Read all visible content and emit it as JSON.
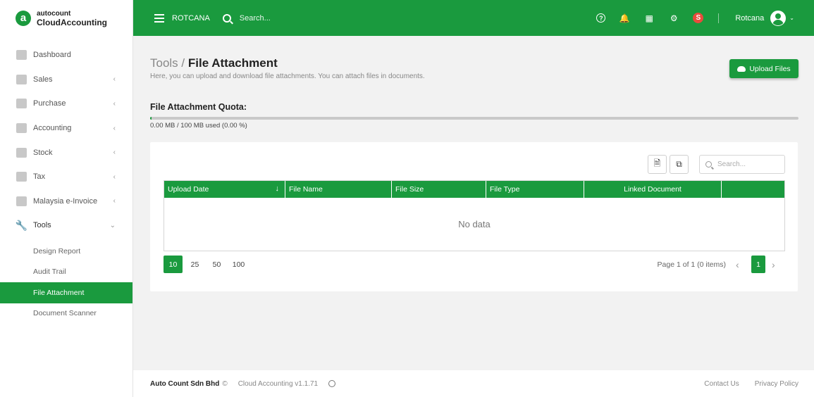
{
  "brand": {
    "top": "autocount",
    "bottom": "CloudAccounting",
    "mark": "a"
  },
  "sidebar": {
    "items": [
      {
        "label": "Dashboard",
        "icon": "dashboard-icon"
      },
      {
        "label": "Sales",
        "icon": "sales-icon"
      },
      {
        "label": "Purchase",
        "icon": "purchase-icon"
      },
      {
        "label": "Accounting",
        "icon": "accounting-icon"
      },
      {
        "label": "Stock",
        "icon": "stock-icon"
      },
      {
        "label": "Tax",
        "icon": "tax-icon"
      },
      {
        "label": "Malaysia e-Invoice",
        "icon": "einvoice-icon"
      },
      {
        "label": "Tools",
        "icon": "wrench-icon"
      }
    ],
    "tools_sub": [
      "Design Report",
      "Audit Trail",
      "File Attachment",
      "Document Scanner"
    ]
  },
  "topbar": {
    "company": "ROTCANA",
    "search_placeholder": "Search...",
    "user_badge": "S",
    "username": "Rotcana"
  },
  "page": {
    "breadcrumb_parent": "Tools",
    "breadcrumb_sep": " / ",
    "title": "File Attachment",
    "subtitle": "Here, you can upload and download file attachments. You can attach files in documents.",
    "upload_label": "Upload Files"
  },
  "quota": {
    "title": "File Attachment Quota:",
    "text": "0.00 MB / 100 MB used (0.00 %)",
    "used_fraction": 0.0
  },
  "grid": {
    "search_placeholder": "Search...",
    "columns": [
      "Upload Date",
      "File Name",
      "File Size",
      "File Type",
      "Linked Document",
      ""
    ],
    "empty_text": "No data"
  },
  "pager": {
    "sizes": [
      "10",
      "25",
      "50",
      "100"
    ],
    "info": "Page 1 of 1 (0 items)",
    "current": "1"
  },
  "footer": {
    "company": "Auto Count Sdn Bhd",
    "copyright": "©",
    "version": "Cloud Accounting v1.1.71",
    "contact": "Contact Us",
    "privacy": "Privacy Policy"
  },
  "colors": {
    "brand_green": "#1a9a3e",
    "badge_red": "#e94b3c"
  }
}
